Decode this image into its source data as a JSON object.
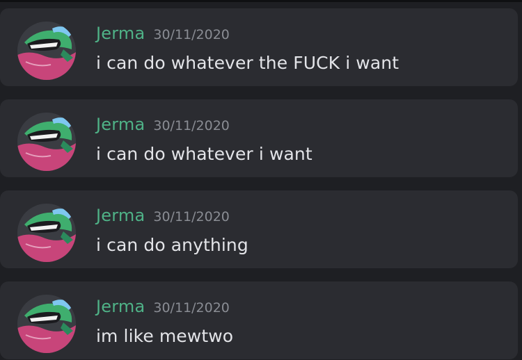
{
  "messages": [
    {
      "username": "Jerma",
      "timestamp": "30/11/2020",
      "text": "i can do whatever the FUCK i want",
      "avatar_icon": "jerma-avatar-icon"
    },
    {
      "username": "Jerma",
      "timestamp": "30/11/2020",
      "text": "i can do whatever i want",
      "avatar_icon": "jerma-avatar-icon"
    },
    {
      "username": "Jerma",
      "timestamp": "30/11/2020",
      "text": "i can do anything",
      "avatar_icon": "jerma-avatar-icon"
    },
    {
      "username": "Jerma",
      "timestamp": "30/11/2020",
      "text": "im like mewtwo",
      "avatar_icon": "jerma-avatar-icon"
    }
  ],
  "colors": {
    "username": "#4fb287",
    "timestamp": "#8a8d94",
    "message_text": "#e3e4e8",
    "message_background": "#2b2c31",
    "page_background": "#1e1f23"
  }
}
